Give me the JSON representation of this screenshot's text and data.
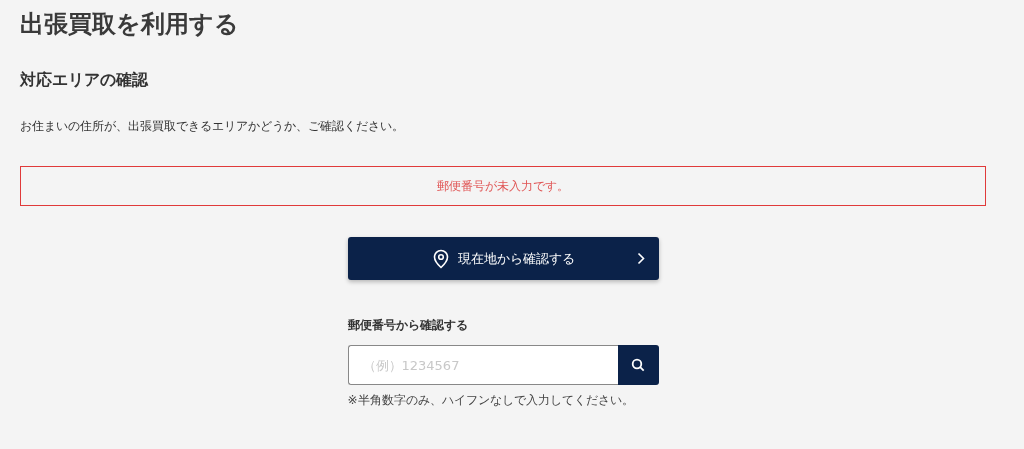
{
  "page_title": "出張買取を利用する",
  "section_title": "対応エリアの確認",
  "description": "お住まいの住所が、出張買取できるエリアかどうか、ご確認ください。",
  "error_message": "郵便番号が未入力です。",
  "location_button": {
    "label": "現在地から確認する"
  },
  "postal_search": {
    "label": "郵便番号から確認する",
    "placeholder": "（例）1234567",
    "hint": "※半角数字のみ、ハイフンなしで入力してください。"
  }
}
